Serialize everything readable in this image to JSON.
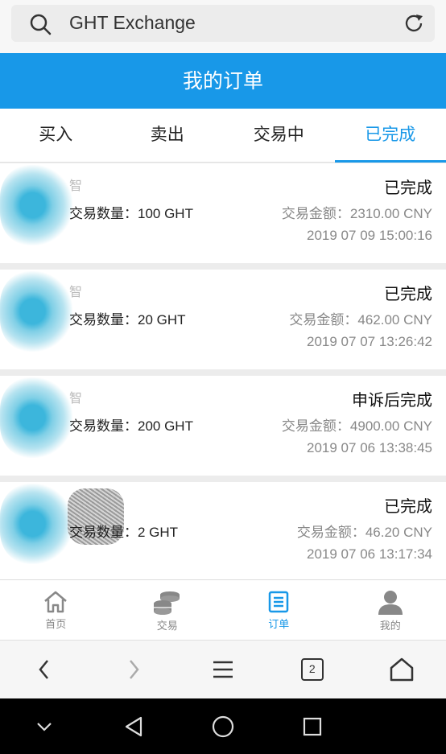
{
  "browser": {
    "search_text": "GHT Exchange",
    "tab_count": "2"
  },
  "header": {
    "title": "我的订单"
  },
  "tabs": [
    {
      "label": "买入",
      "active": false
    },
    {
      "label": "卖出",
      "active": false
    },
    {
      "label": "交易中",
      "active": false
    },
    {
      "label": "已完成",
      "active": true
    }
  ],
  "orders": [
    {
      "name_char": "智",
      "status": "已完成",
      "qty_label": "交易数量：",
      "qty": "100 GHT",
      "amount_label": "交易金额：",
      "amount": "2310.00 CNY",
      "time": "2019 07 09 15:00:16"
    },
    {
      "name_char": "智",
      "status": "已完成",
      "qty_label": "交易数量：",
      "qty": "20 GHT",
      "amount_label": "交易金额：",
      "amount": "462.00 CNY",
      "time": "2019 07 07 13:26:42"
    },
    {
      "name_char": "智",
      "status": "申诉后完成",
      "qty_label": "交易数量：",
      "qty": "200 GHT",
      "amount_label": "交易金额：",
      "amount": "4900.00 CNY",
      "time": "2019 07 06 13:38:45"
    },
    {
      "name_char": "",
      "status": "已完成",
      "qty_label": "交易数量：",
      "qty": "2 GHT",
      "amount_label": "交易金额：",
      "amount": "46.20 CNY",
      "time": "2019 07 06 13:17:34"
    }
  ],
  "bottom_nav": [
    {
      "label": "首页",
      "icon": "home-icon",
      "active": false
    },
    {
      "label": "交易",
      "icon": "coins-icon",
      "active": false
    },
    {
      "label": "订单",
      "icon": "list-icon",
      "active": true
    },
    {
      "label": "我的",
      "icon": "user-icon",
      "active": false
    }
  ],
  "colors": {
    "accent": "#1898e8",
    "inactive": "#888888"
  }
}
